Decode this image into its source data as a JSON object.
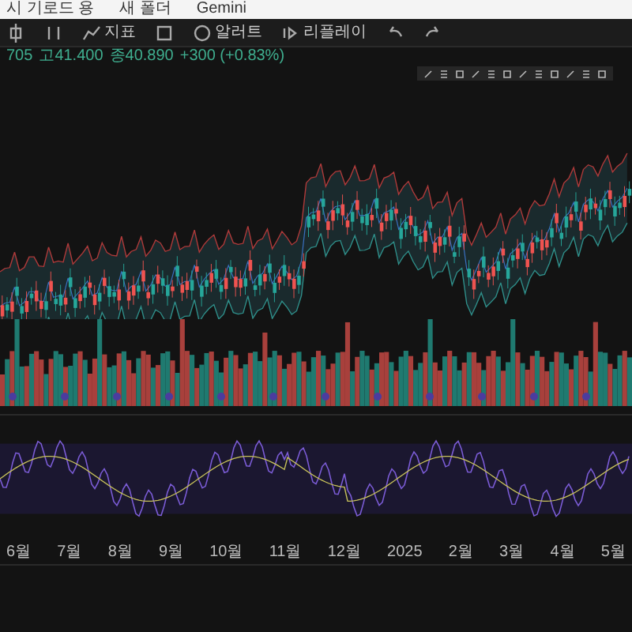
{
  "bookmarks": [
    {
      "label": "시 기로드 용"
    },
    {
      "label": "새 폴더"
    },
    {
      "label": "Gemini"
    }
  ],
  "toolbar": [
    {
      "kind": "icon"
    },
    {
      "kind": "icon"
    },
    {
      "kind": "button",
      "label": "지표"
    },
    {
      "kind": "icon"
    },
    {
      "kind": "button",
      "label": "알러트"
    },
    {
      "kind": "button",
      "label": "리플레이"
    },
    {
      "kind": "icon"
    },
    {
      "kind": "icon"
    }
  ],
  "legend": [
    {
      "text": "705"
    },
    {
      "text": "고41.400"
    },
    {
      "text": "종40.890"
    },
    {
      "text": "+300 (+0.83%)"
    }
  ],
  "time_axis": [
    "6월",
    "7월",
    "8월",
    "9월",
    "10월",
    "11월",
    "12월",
    "2025",
    "2월",
    "3월",
    "4월",
    "5월"
  ]
}
